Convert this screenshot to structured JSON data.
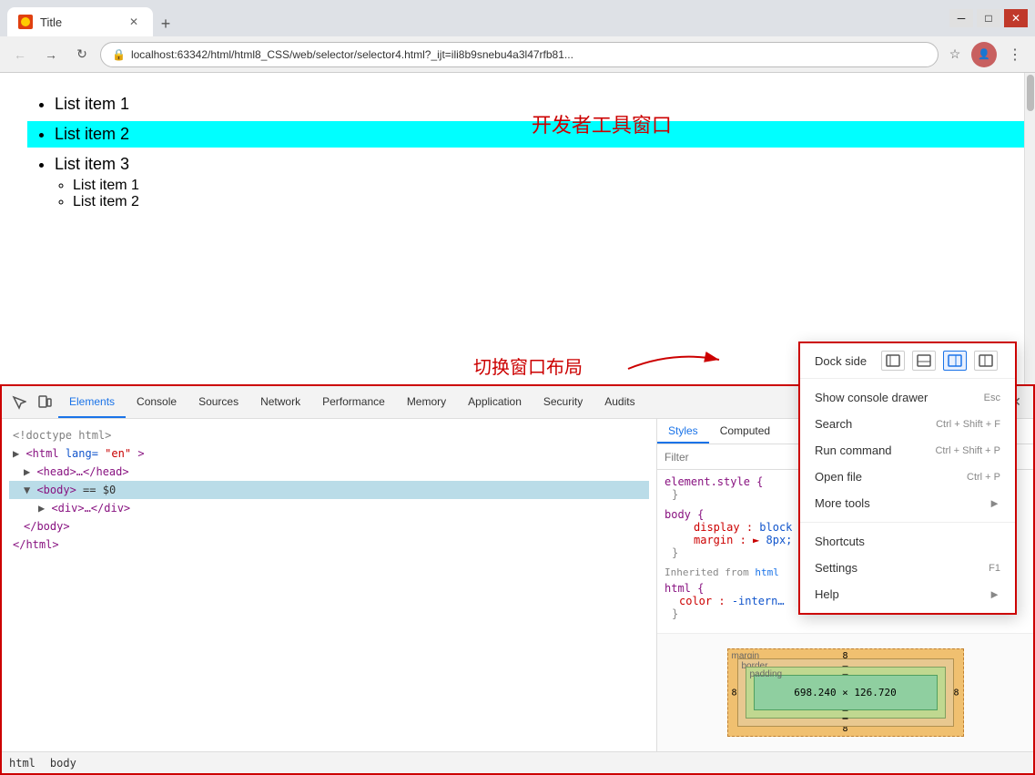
{
  "browser": {
    "tab_title": "Title",
    "url": "localhost:63342/html/html8_CSS/web/selector/selector4.html?_ijt=ili8b9snebu4a3l47rfb81...",
    "new_tab_tooltip": "New tab"
  },
  "page": {
    "list_items": [
      "List item 1",
      "List item 2",
      "List item 3"
    ],
    "sub_items": [
      "List item 1",
      "List item 2"
    ],
    "highlighted_item": "List item 2",
    "dev_tools_label": "开发者工具窗口",
    "switch_layout_label": "切换窗口布局"
  },
  "devtools": {
    "tabs": [
      {
        "label": "Elements",
        "active": true
      },
      {
        "label": "Console",
        "active": false
      },
      {
        "label": "Sources",
        "active": false
      },
      {
        "label": "Network",
        "active": false
      },
      {
        "label": "Performance",
        "active": false
      },
      {
        "label": "Memory",
        "active": false
      },
      {
        "label": "Application",
        "active": false
      },
      {
        "label": "Security",
        "active": false
      },
      {
        "label": "Audits",
        "active": false
      }
    ],
    "styles_tabs": [
      {
        "label": "Styles",
        "active": true
      },
      {
        "label": "Computed",
        "active": false
      }
    ],
    "filter_placeholder": "Filter",
    "html_lines": [
      {
        "text": "<!doctype html>",
        "type": "comment",
        "indent": 0
      },
      {
        "text": "<html lang=\"en\">",
        "type": "tag",
        "indent": 0
      },
      {
        "text": "<head>…</head>",
        "type": "tag",
        "indent": 1
      },
      {
        "text": "<body> == $0",
        "type": "selected",
        "indent": 1
      },
      {
        "text": "<div>…</div>",
        "type": "tag",
        "indent": 2
      },
      {
        "text": "</body>",
        "type": "tag",
        "indent": 1
      },
      {
        "text": "</html>",
        "type": "tag",
        "indent": 0
      }
    ],
    "styles": {
      "element_style": "element.style {",
      "body_style_selector": "body {",
      "body_display": "display: block",
      "body_margin": "margin: ► 8px;",
      "inherited_label": "Inherited from html",
      "html_selector": "html {",
      "html_color": "color: -intern…"
    },
    "box_model": {
      "margin_label": "margin",
      "margin_value": "8",
      "border_label": "border",
      "border_value": "–",
      "padding_label": "padding",
      "padding_value": "–",
      "content_size": "698.240 × 126.720",
      "dash": "–"
    }
  },
  "context_menu": {
    "dock_side_label": "Dock side",
    "items": [
      {
        "label": "Show console drawer",
        "shortcut": "Esc",
        "has_arrow": false
      },
      {
        "label": "Search",
        "shortcut": "Ctrl + Shift + F",
        "has_arrow": false
      },
      {
        "label": "Run command",
        "shortcut": "Ctrl + Shift + P",
        "has_arrow": false
      },
      {
        "label": "Open file",
        "shortcut": "Ctrl + P",
        "has_arrow": false
      },
      {
        "label": "More tools",
        "shortcut": "",
        "has_arrow": true
      },
      {
        "label": "Shortcuts",
        "shortcut": "",
        "has_arrow": false
      },
      {
        "label": "Settings",
        "shortcut": "F1",
        "has_arrow": false
      },
      {
        "label": "Help",
        "shortcut": "",
        "has_arrow": true
      }
    ]
  },
  "status_bar": {
    "items": [
      "html",
      "body"
    ]
  }
}
